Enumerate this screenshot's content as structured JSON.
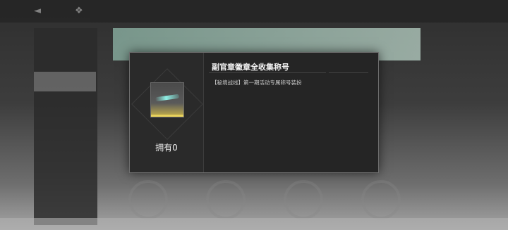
{
  "modal": {
    "title": "副官章徽章全收集称号",
    "description": "【秘境战线】第一期活动专属称号装扮",
    "owned_label": "拥有0"
  },
  "icons": {
    "share": "share-icon",
    "settings": "gear-icon"
  },
  "colors": {
    "modal_bg": "#252525",
    "banner_accent": "#9fc3b4",
    "item_gold": "#e8d25c",
    "item_cyan": "#8ff0e6"
  }
}
